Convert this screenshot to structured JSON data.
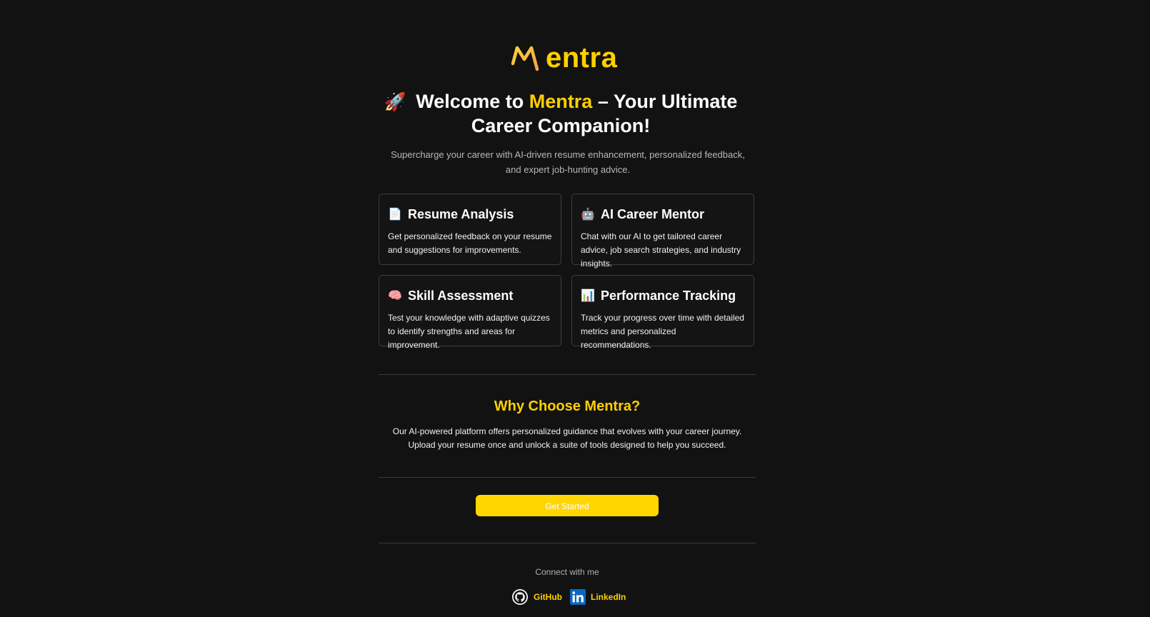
{
  "brand": {
    "logo_text": "entra",
    "accent_color": "#ffd000"
  },
  "hero": {
    "emoji": "🚀",
    "title_prefix": "Welcome to",
    "title_accent": "Mentra",
    "title_suffix": "– Your Ultimate Career Companion!",
    "subtitle": "Supercharge your career with AI-driven resume enhancement, personalized feedback, and expert job-hunting advice."
  },
  "features": [
    {
      "icon": "page-icon",
      "emoji": "📄",
      "title": "Resume Analysis",
      "description": "Get personalized feedback on your resume and suggestions for improvements."
    },
    {
      "icon": "robot-icon",
      "emoji": "🤖",
      "title": "AI Career Mentor",
      "description": "Chat with our AI to get tailored career advice, job search strategies, and industry insights."
    },
    {
      "icon": "brain-icon",
      "emoji": "🧠",
      "title": "Skill Assessment",
      "description": "Test your knowledge with adaptive quizzes to identify strengths and areas for improvement."
    },
    {
      "icon": "chart-icon",
      "emoji": "📊",
      "title": "Performance Tracking",
      "description": "Track your progress over time with detailed metrics and personalized recommendations."
    }
  ],
  "why": {
    "title": "Why Choose Mentra?",
    "text": "Our AI-powered platform offers personalized guidance that evolves with your career journey. Upload your resume once and unlock a suite of tools designed to help you succeed."
  },
  "cta": {
    "label": "Get Started",
    "color": "#ffd600"
  },
  "footer": {
    "connect_label": "Connect with me",
    "links": [
      {
        "icon": "github-icon",
        "label": "GitHub"
      },
      {
        "icon": "linkedin-icon",
        "label": "LinkedIn",
        "color": "#0a66c2"
      }
    ]
  }
}
